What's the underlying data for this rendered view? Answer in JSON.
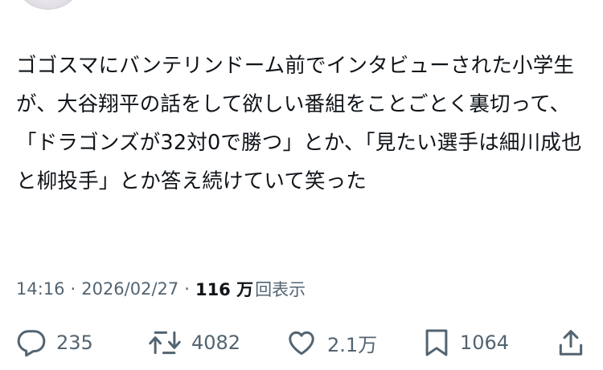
{
  "tweet": {
    "text": "ゴゴスマにバンテリンドーム前でインタビューされた小学生が、大谷翔平の話をして欲しい番組をことごとく裏切って、「ドラゴンズが32対0で勝つ」とか、「見たい選手は細川成也と柳投手」とか答え続けていて笑った"
  },
  "meta": {
    "time": "14:16",
    "separator": "·",
    "date": "2026/02/27",
    "views_count": "116 万",
    "views_label": "回表示"
  },
  "actions": {
    "reply": {
      "icon": "reply-icon",
      "count": "235"
    },
    "retweet": {
      "icon": "retweet-icon",
      "count": "4082"
    },
    "like": {
      "icon": "heart-icon",
      "count": "2.1万"
    },
    "bookmark": {
      "icon": "bookmark-icon",
      "count": "1064"
    },
    "share": {
      "icon": "share-icon"
    }
  },
  "colors": {
    "text": "#0f1419",
    "secondary": "#536471",
    "background": "#ffffff"
  }
}
